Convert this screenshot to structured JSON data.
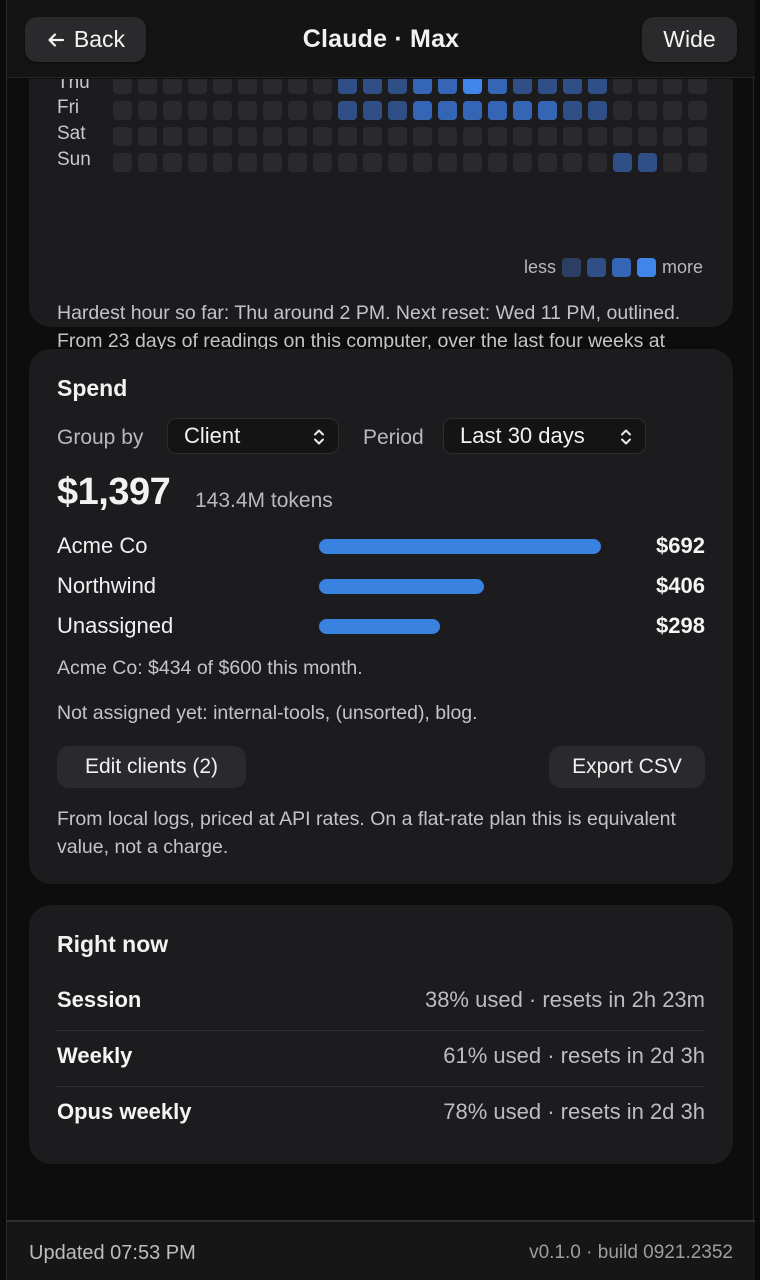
{
  "header": {
    "back_label": "Back",
    "title": "Claude · Max",
    "wide_label": "Wide"
  },
  "heatmap": {
    "rows": [
      {
        "day": "Thu",
        "levels": [
          0,
          0,
          0,
          0,
          0,
          0,
          0,
          0,
          0,
          2,
          2,
          2,
          3,
          3,
          4,
          3,
          2,
          2,
          2,
          2,
          0,
          0,
          0,
          0
        ]
      },
      {
        "day": "Fri",
        "levels": [
          0,
          0,
          0,
          0,
          0,
          0,
          0,
          0,
          0,
          2,
          2,
          2,
          3,
          3,
          3,
          3,
          3,
          3,
          2,
          2,
          0,
          0,
          0,
          0
        ]
      },
      {
        "day": "Sat",
        "levels": [
          0,
          0,
          0,
          0,
          0,
          0,
          0,
          0,
          0,
          0,
          0,
          0,
          0,
          0,
          0,
          0,
          0,
          0,
          0,
          0,
          0,
          0,
          0,
          0
        ]
      },
      {
        "day": "Sun",
        "levels": [
          0,
          0,
          0,
          0,
          0,
          0,
          0,
          0,
          0,
          0,
          0,
          0,
          0,
          0,
          0,
          0,
          0,
          0,
          0,
          0,
          2,
          2,
          0,
          0
        ]
      }
    ],
    "legend_less": "less",
    "legend_more": "more",
    "level_colors": [
      "#2a2a2d",
      "#2c3f63",
      "#2f4f86",
      "#3566b6",
      "#3f86e8"
    ],
    "note": "Hardest hour so far: Thu around 2 PM. Next reset: Wed 11 PM, outlined. From 23 days of readings on this computer, over the last four weeks at most."
  },
  "spend": {
    "title": "Spend",
    "group_by_label": "Group by",
    "group_by_value": "Client",
    "period_label": "Period",
    "period_value": "Last 30 days",
    "total": "$1,397",
    "tokens": "143.4M tokens",
    "clients": [
      {
        "name": "Acme Co",
        "value": "$692",
        "amount": 692
      },
      {
        "name": "Northwind",
        "value": "$406",
        "amount": 406
      },
      {
        "name": "Unassigned",
        "value": "$298",
        "amount": 298
      }
    ],
    "budget_note": "Acme Co: $434 of $600 this month.",
    "unassigned_note": "Not assigned yet: internal-tools, (unsorted), blog.",
    "edit_clients_label": "Edit clients (2)",
    "export_label": "Export CSV",
    "footnote": "From local logs, priced at API rates. On a flat-rate plan this is equivalent value, not a charge.",
    "bar_color": "#3a82e0"
  },
  "right_now": {
    "title": "Right now",
    "rows": [
      {
        "label": "Session",
        "value": "38% used · resets in 2h 23m"
      },
      {
        "label": "Weekly",
        "value": "61% used · resets in 2d 3h"
      },
      {
        "label": "Opus weekly",
        "value": "78% used · resets in 2d 3h"
      }
    ]
  },
  "footer": {
    "updated": "Updated 07:53 PM",
    "version": "v0.1.0 · build 0921.2352"
  }
}
